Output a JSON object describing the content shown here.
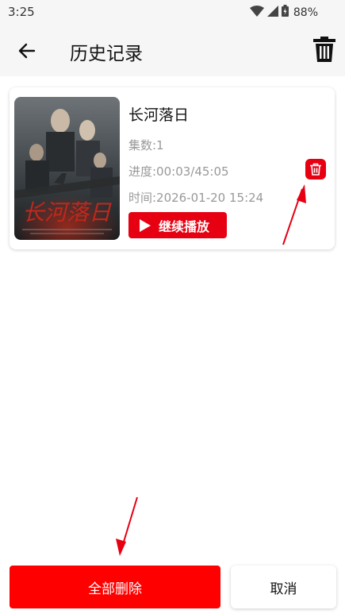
{
  "status": {
    "time": "3:25",
    "battery": "88%"
  },
  "header": {
    "title": "历史记录",
    "back_icon": "arrow-left-icon",
    "trash_icon": "trash-icon"
  },
  "history": {
    "items": [
      {
        "title": "长河落日",
        "episodes": "集数:1",
        "progress": "进度:00:03/45:05",
        "time": "时间:2026-01-20 15:24",
        "continue_label": "继续播放",
        "poster_text": "长河落日"
      }
    ]
  },
  "footer": {
    "delete_all_label": "全部删除",
    "cancel_label": "取消"
  },
  "colors": {
    "accent": "#e60012",
    "primary_button": "#ff0000",
    "meta_text": "#999999"
  }
}
